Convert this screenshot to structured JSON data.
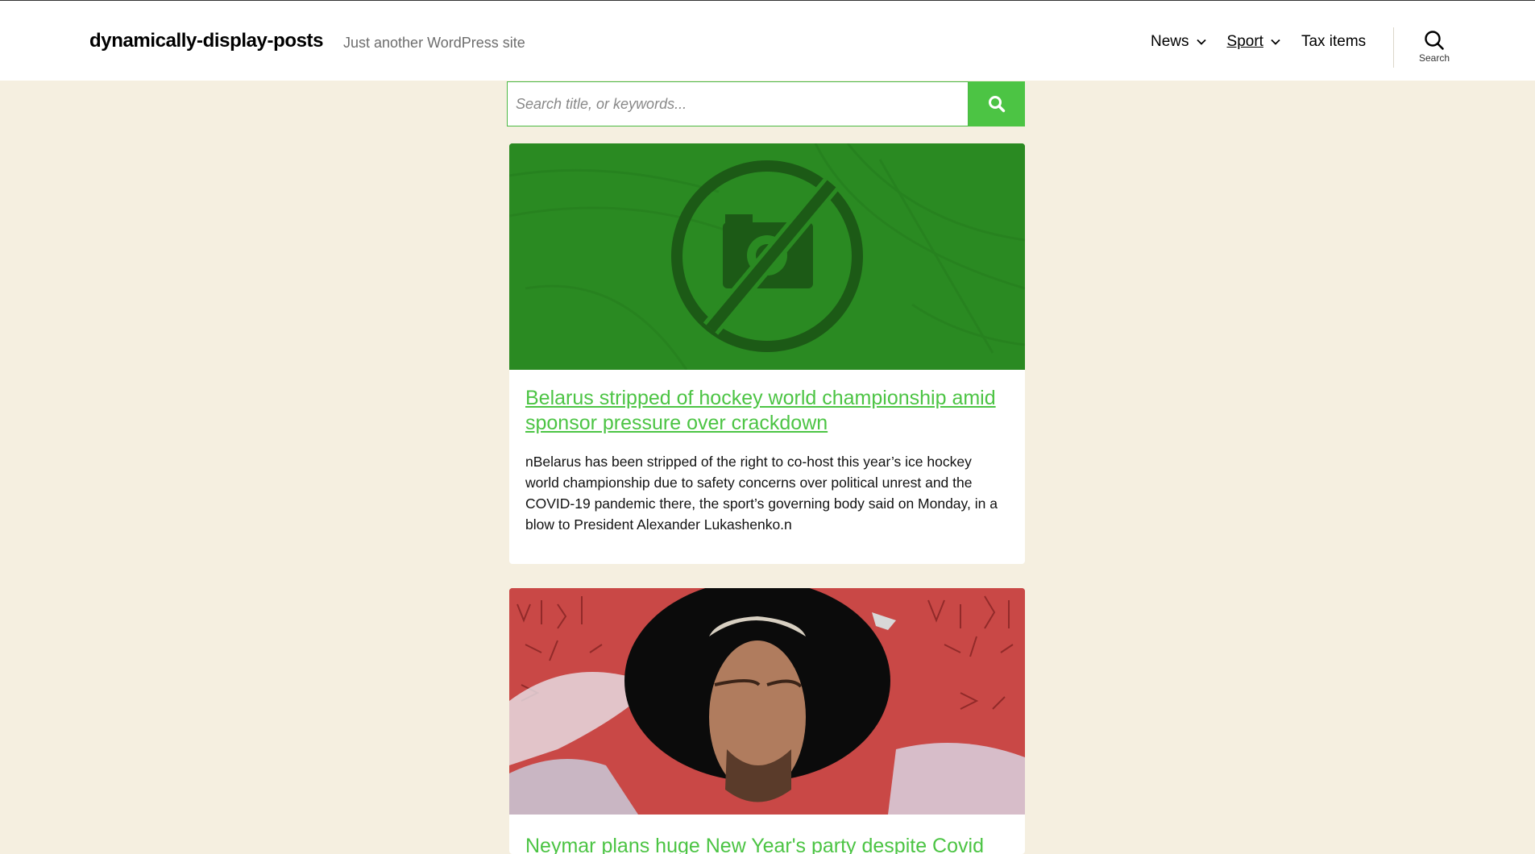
{
  "header": {
    "site_title": "dynamically-display-posts",
    "site_description": "Just another WordPress site",
    "nav": [
      {
        "label": "News"
      },
      {
        "label": "Sport"
      },
      {
        "label": "Tax items"
      }
    ],
    "search_toggle_label": "Search"
  },
  "search": {
    "placeholder": "Search title, or keywords..."
  },
  "posts": [
    {
      "title": "Belarus stripped of hockey world championship amid sponsor pressure over crackdown",
      "excerpt": "nBelarus has been stripped of the right to co-host this year’s ice hockey world championship due to safety concerns over political unrest and the COVID-19 pandemic there, the sport’s governing body said on Monday, in a blow to President Alexander Lukashenko.n"
    },
    {
      "title": "Neymar plans huge New Year's party despite Covid"
    }
  ],
  "colors": {
    "accent": "#4cc444",
    "page_bg": "#f5efe0",
    "placeholder_image_bg": "#2a8a22"
  }
}
